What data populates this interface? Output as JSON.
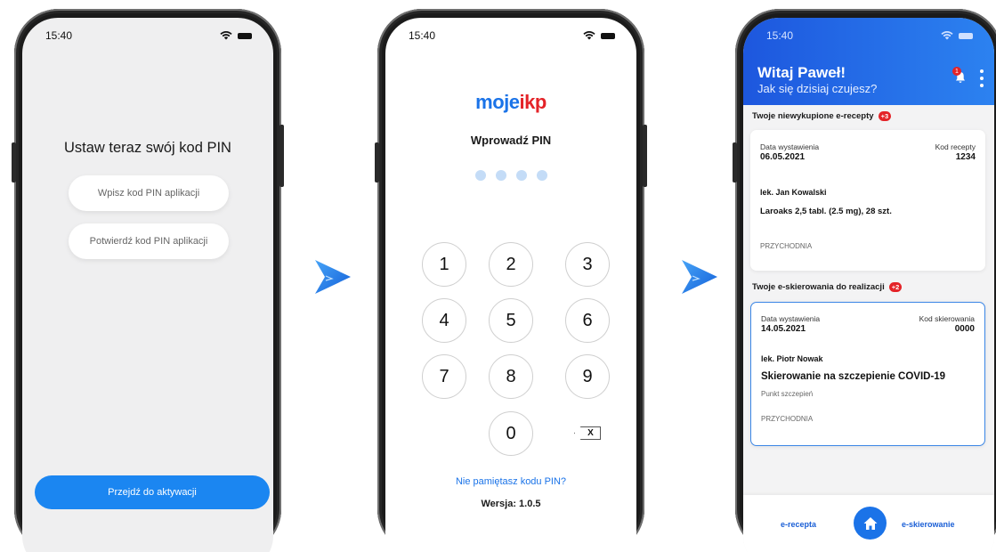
{
  "phone1": {
    "time": "15:40",
    "title": "Ustaw teraz swój kod PIN",
    "pin_placeholder": "Wpisz kod PIN aplikacji",
    "confirm_placeholder": "Potwierdź kod PIN aplikacji",
    "activate_button": "Przejdź do aktywacji"
  },
  "phone2": {
    "time": "15:40",
    "logo_part1": "moje",
    "logo_part2": "ikp",
    "title": "Wprowadź PIN",
    "pin_dots": 4,
    "keys": [
      "1",
      "2",
      "3",
      "4",
      "5",
      "6",
      "7",
      "8",
      "9",
      "0"
    ],
    "backspace": "X",
    "forgot_link": "Nie pamiętasz kodu PIN?",
    "version": "Wersja: 1.0.5"
  },
  "phone3": {
    "time": "15:40",
    "greeting": "Witaj Paweł!",
    "subtitle": "Jak się dzisiaj czujesz?",
    "notification_count": "1",
    "prescriptions": {
      "title": "Twoje niewykupione e-recepty",
      "badge": "+3",
      "issue_label": "Data wystawienia",
      "issue_date": "06.05.2021",
      "code_label": "Kod recepty",
      "code": "1234",
      "doctor": "lek. Jan Kowalski",
      "medicine": "Laroaks 2,5 tabl. (2.5 mg), 28 szt.",
      "facility": "PRZYCHODNIA"
    },
    "referrals": {
      "title": "Twoje e-skierowania do realizacji",
      "badge": "+2",
      "issue_label": "Data wystawienia",
      "issue_date": "14.05.2021",
      "code_label": "Kod skierowania",
      "code": "0000",
      "doctor": "lek. Piotr Nowak",
      "referral": "Skierowanie na szczepienie COVID-19",
      "place": "Punkt szczepień",
      "facility": "PRZYCHODNIA"
    },
    "nav": {
      "left": "e-recepta",
      "right": "e-skierowanie"
    }
  },
  "colors": {
    "accent": "#1b86f1",
    "brand_red": "#e42328",
    "header_blue": "#1d57de"
  }
}
